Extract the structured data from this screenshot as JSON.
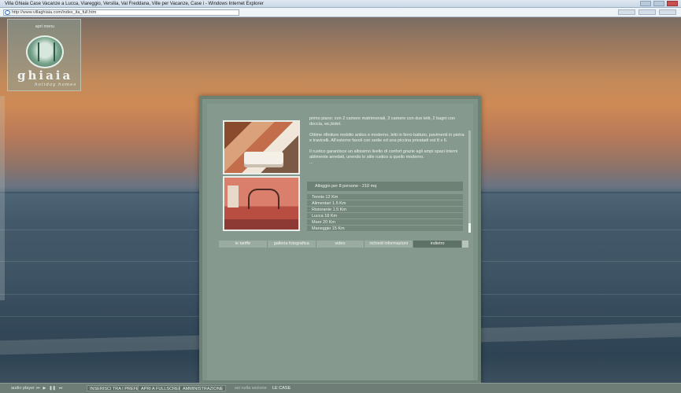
{
  "browser": {
    "window_title": "Villa Ghiaia Case Vacanze a Lucca, Viareggio, Versilia, Val Freddana, Ville per Vacanze, Case i - Windows Internet Explorer",
    "url": "http://www.villaghiaia.com/index_ita_full.htm"
  },
  "logo": {
    "menu_label": "apri menu",
    "brand": "ghiaia",
    "tagline": "holiday homes"
  },
  "description": {
    "p1": "primo piano: con 2 camere matrimoniali, 2 camere con due letti, 2 bagni con doccia, wc,bidet.",
    "p2": "Ottime rifiniture mobilio antico e moderno, letti in ferro battuto, pavimenti in pietra e travicelli. All'esterno favoli con sedie ed una piccina privatadi est 8 x 6.",
    "p3": "Il rustico garantisce un altissimo livello di confort grazie agli ampi spazi interni ablimente arredati, unendo lo stile rustico a quello moderno.",
    "ellipsis": "..."
  },
  "capacity": "Alloggio per 8 persone  -  210 mq",
  "distances": [
    "Tennis 12 Km",
    "Alimentari 1.5 Km",
    "Ristorante 1.5 Km",
    "Lucca 18 Km",
    "Mare 20 Km",
    "Maneggio 15 Km"
  ],
  "tabs": [
    {
      "label": "le tariffe",
      "active": false
    },
    {
      "label": "galleria fotografica",
      "active": false
    },
    {
      "label": "video",
      "active": false
    },
    {
      "label": "richiedi informazioni",
      "active": false
    },
    {
      "label": "indietro",
      "active": true
    }
  ],
  "bottombar": {
    "audio_label": "audio player",
    "favorites": "INSERISCI TRA I PREFERITI",
    "fullscreen": "APRI A FULLSCREEN",
    "admin": "AMMINISTRAZIONE",
    "section_label": "sei nella sezione",
    "current_section": "LE CASE"
  },
  "colors": {
    "panel": "#7e9487",
    "accent": "#5e7166"
  }
}
